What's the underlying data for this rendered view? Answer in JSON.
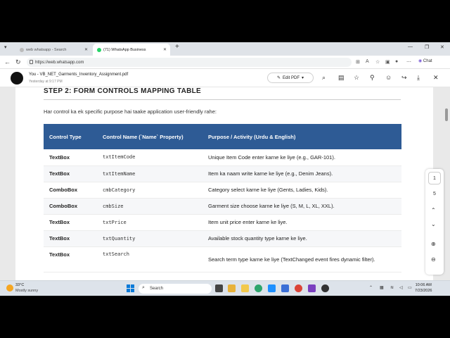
{
  "browser": {
    "tabs": [
      {
        "title": "web whatsapp - Search",
        "active": false
      },
      {
        "title": "(71) WhatsApp Business",
        "active": true
      }
    ],
    "url": "https://web.whatsapp.com",
    "chat_label": "Chat"
  },
  "pdf": {
    "sender_filename": "You - VB_NET_Garments_Inventory_Assignment.pdf",
    "timestamp": "Yesterday at 9:17 PM",
    "edit_label": "Edit PDF"
  },
  "document": {
    "heading": "STEP 2: FORM CONTROLS MAPPING TABLE",
    "intro": "Har control ka ek specific purpose hai taake application user-friendly rahe:",
    "table": {
      "headers": [
        "Control Type",
        "Control Name (`Name` Property)",
        "Purpose / Activity (Urdu & English)"
      ],
      "rows": [
        [
          "TextBox",
          "txtItemCode",
          "Unique Item Code enter karne ke liye (e.g., GAR-101)."
        ],
        [
          "TextBox",
          "txtItemName",
          "Item ka naam write karne ke liye (e.g., Denim Jeans)."
        ],
        [
          "ComboBox",
          "cmbCategory",
          "Category select karne ke liye (Gents, Ladies, Kids)."
        ],
        [
          "ComboBox",
          "cmbSize",
          "Garment size choose karne ke liye (S, M, L, XL, XXL)."
        ],
        [
          "TextBox",
          "txtPrice",
          "Item unit price enter karne ke liye."
        ],
        [
          "TextBox",
          "txtQuantity",
          "Available stock quantity type karne ke liye."
        ],
        [
          "TextBox",
          "txtSearch",
          "Search term type karne ke liye (TextChanged event fires dynamic filter)."
        ]
      ]
    }
  },
  "side_panel": {
    "current_page": "1",
    "total_pages": "5"
  },
  "taskbar": {
    "temperature": "33°C",
    "weather": "Mostly sunny",
    "search_placeholder": "Search",
    "time": "10:06 AM",
    "date": "7/23/2026"
  },
  "colors": {
    "table_header": "#2e5b95",
    "accent": "#0a7ad8"
  }
}
